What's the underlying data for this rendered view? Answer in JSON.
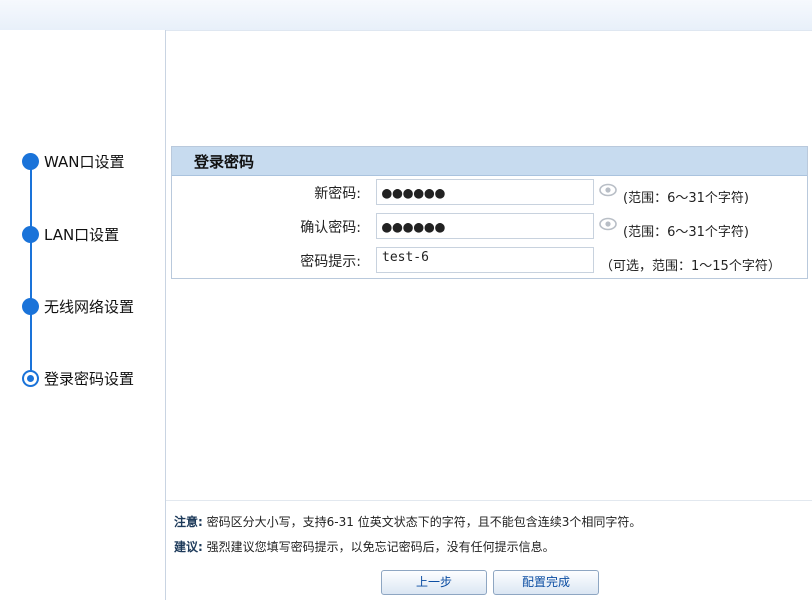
{
  "steps": [
    {
      "label": "WAN口设置",
      "state": "done"
    },
    {
      "label": "LAN口设置",
      "state": "done"
    },
    {
      "label": "无线网络设置",
      "state": "done"
    },
    {
      "label": "登录密码设置",
      "state": "current"
    }
  ],
  "panel": {
    "title": "登录密码",
    "fields": [
      {
        "label": "新密码:",
        "value": "●●●●●●",
        "hint": "(范围：6～31个字符)",
        "icon": "eye-icon"
      },
      {
        "label": "确认密码:",
        "value": "●●●●●●",
        "hint": "(范围：6～31个字符)",
        "icon": "eye-icon"
      },
      {
        "label": "密码提示:",
        "value": "test-6",
        "hint": "（可选，范围：1～15个字符）"
      }
    ]
  },
  "notes": [
    {
      "key": "注意:",
      "text": "密码区分大小写，支持6-31 位英文状态下的字符，且不能包含连续3个相同字符。"
    },
    {
      "key": "建议:",
      "text": "强烈建议您填写密码提示，以免忘记密码后，没有任何提示信息。"
    }
  ],
  "buttons": {
    "prev": "上一步",
    "finish": "配置完成"
  },
  "colors": {
    "accent": "#1a73d9",
    "panel_header": "#c7dbef",
    "button_text": "#0b4da2"
  }
}
